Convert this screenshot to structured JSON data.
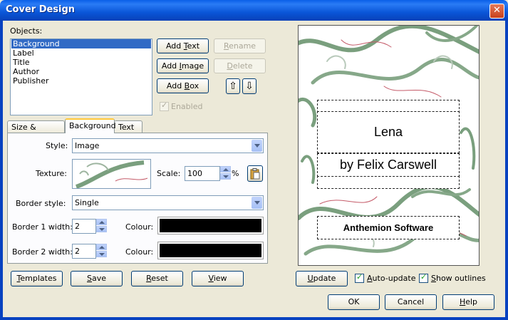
{
  "window": {
    "title": "Cover Design",
    "close_symbol": "✕"
  },
  "objects": {
    "label": "Objects:",
    "items": [
      "Background",
      "Label",
      "Title",
      "Author",
      "Publisher"
    ],
    "selected": "Background"
  },
  "object_buttons": {
    "add_text": {
      "pre": "Add ",
      "u": "T",
      "post": "ext"
    },
    "add_image": {
      "pre": "Add ",
      "u": "I",
      "post": "mage"
    },
    "add_box": {
      "pre": "Add ",
      "u": "B",
      "post": "ox"
    },
    "rename": {
      "pre": "",
      "u": "R",
      "post": "ename"
    },
    "delete": {
      "pre": "",
      "u": "D",
      "post": "elete"
    },
    "move_up_symbol": "⇧",
    "move_down_symbol": "⇩",
    "enabled_label": "Enabled"
  },
  "tabs": [
    "Size & Position",
    "Background",
    "Text"
  ],
  "active_tab": "Background",
  "background_tab": {
    "style_label": "Style:",
    "style_value": "Image",
    "texture_label": "Texture:",
    "scale_label": "Scale:",
    "scale_value": "100",
    "scale_unit": "%",
    "border_style_label": "Border style:",
    "border_style_value": "Single",
    "border1_label": "Border 1 width:",
    "border1_value": "2",
    "border2_label": "Border 2 width:",
    "border2_value": "2",
    "colour_label": "Colour:",
    "colour1": "#000000",
    "colour2": "#000000"
  },
  "bottom_buttons": {
    "templates": {
      "pre": "",
      "u": "T",
      "post": "emplates"
    },
    "save": {
      "pre": "",
      "u": "S",
      "post": "ave"
    },
    "reset": {
      "pre": "",
      "u": "R",
      "post": "eset"
    },
    "view": {
      "pre": "",
      "u": "V",
      "post": "iew"
    }
  },
  "preview": {
    "title": "Lena",
    "author": "by Felix Carswell",
    "publisher": "Anthemion Software"
  },
  "preview_controls": {
    "update": {
      "pre": "",
      "u": "U",
      "post": "pdate"
    },
    "auto_update": {
      "pre": "",
      "u": "A",
      "post": "uto-update"
    },
    "auto_update_checked": true,
    "show_outlines": {
      "pre": "",
      "u": "S",
      "post": "how outlines"
    },
    "show_outlines_checked": true
  },
  "dialog_buttons": {
    "ok": "OK",
    "cancel": "Cancel",
    "help": {
      "pre": "",
      "u": "H",
      "post": "elp"
    }
  }
}
